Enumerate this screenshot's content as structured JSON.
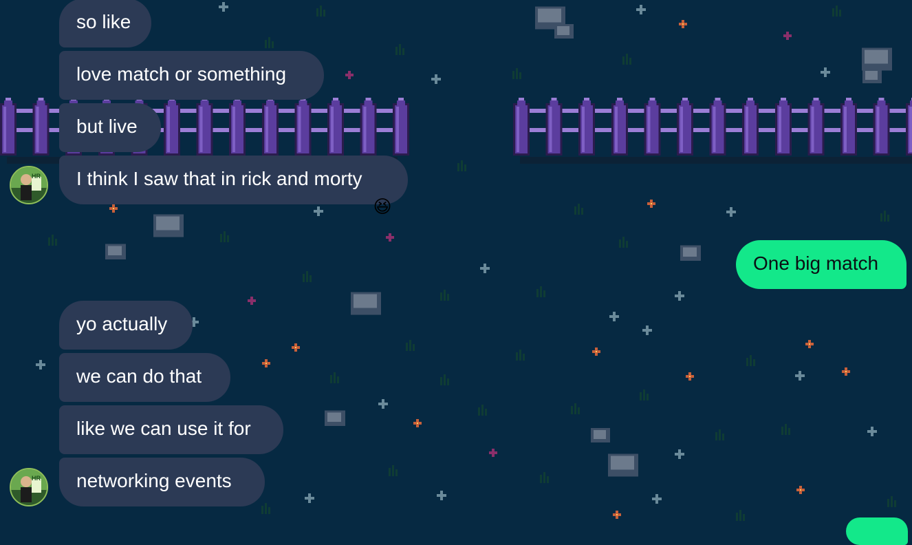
{
  "theme": {
    "background": "#062942",
    "incoming_bubble": "#2c3a55",
    "outgoing_bubble": "#13e88a",
    "fence": "#5b3d9e"
  },
  "messages": {
    "group1": [
      {
        "text": "so like",
        "sender": "other"
      },
      {
        "text": "love match or something",
        "sender": "other"
      },
      {
        "text": "but live",
        "sender": "other"
      },
      {
        "text": "I think I saw that in rick and morty",
        "sender": "other",
        "reaction": "😆"
      }
    ],
    "outgoing1": {
      "text": "One big match",
      "sender": "me"
    },
    "group2": [
      {
        "text": "yo actually",
        "sender": "other"
      },
      {
        "text": "we can do that",
        "sender": "other"
      },
      {
        "text": "like we can use it for",
        "sender": "other"
      },
      {
        "text": "networking events",
        "sender": "other"
      }
    ]
  },
  "avatar": {
    "label": "HR"
  }
}
